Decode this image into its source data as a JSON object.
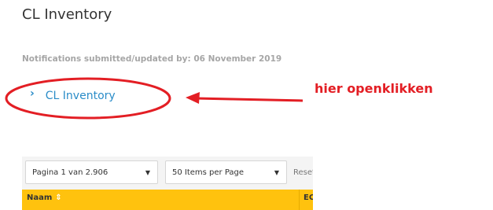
{
  "page": {
    "title": "CL Inventory"
  },
  "notifications": {
    "text": "Notifications submitted/updated by: 06 November 2019"
  },
  "tree": {
    "item_label": "CL Inventory",
    "chevron": "›"
  },
  "annotation": {
    "text": "hier openklikken",
    "color": "#e31e24"
  },
  "toolbar": {
    "page_select": "Pagina 1 van 2.906",
    "items_select": "50 Items per Page",
    "reset_label": "Reset"
  },
  "table": {
    "columns": [
      "Naam",
      "EC"
    ],
    "header_color": "#ffc20e"
  },
  "colors": {
    "link": "#2a8cc8",
    "title": "#333333"
  }
}
